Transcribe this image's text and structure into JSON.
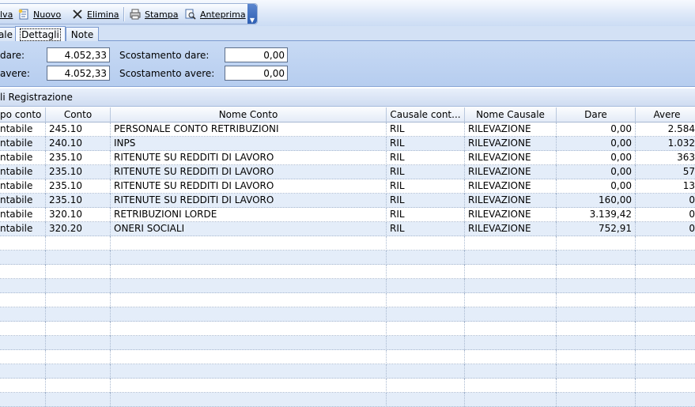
{
  "toolbar": {
    "buttons": [
      {
        "label": "lva",
        "icon": "save-icon"
      },
      {
        "label": "Nuovo",
        "icon": "new-document-icon"
      },
      {
        "label": "Elimina",
        "icon": "delete-x-icon"
      },
      {
        "label": "Stampa",
        "icon": "printer-icon"
      },
      {
        "label": "Anteprima",
        "icon": "print-preview-icon"
      }
    ],
    "more_icon": "chevron-down-icon"
  },
  "tabs": [
    {
      "label": "ale",
      "active": false
    },
    {
      "label": "Dettagli",
      "active": true
    },
    {
      "label": "Note",
      "active": false
    }
  ],
  "totals": {
    "dare_label": "dare:",
    "dare_value": "4.052,33",
    "avere_label": "avere:",
    "avere_value": "4.052,33",
    "scost_dare_label": "Scostamento dare:",
    "scost_dare_value": "0,00",
    "scost_avere_label": "Scostamento avere:",
    "scost_avere_value": "0,00"
  },
  "grid_title": "li Registrazione",
  "columns": [
    "po conto",
    "Conto",
    "Nome Conto",
    "Causale cont...",
    "Nome Causale",
    "Dare",
    "Avere"
  ],
  "rows": [
    [
      "ntabile",
      "245.10",
      "PERSONALE CONTO RETRIBUZIONI",
      "RIL",
      "RILEVAZIONE",
      "0,00",
      "2.584"
    ],
    [
      "ntabile",
      "240.10",
      "INPS",
      "RIL",
      "RILEVAZIONE",
      "0,00",
      "1.032"
    ],
    [
      "ntabile",
      "235.10",
      "RITENUTE SU REDDITI DI LAVORO",
      "RIL",
      "RILEVAZIONE",
      "0,00",
      "363"
    ],
    [
      "ntabile",
      "235.10",
      "RITENUTE SU REDDITI DI LAVORO",
      "RIL",
      "RILEVAZIONE",
      "0,00",
      "57"
    ],
    [
      "ntabile",
      "235.10",
      "RITENUTE SU REDDITI DI LAVORO",
      "RIL",
      "RILEVAZIONE",
      "0,00",
      "13"
    ],
    [
      "ntabile",
      "235.10",
      "RITENUTE SU REDDITI DI LAVORO",
      "RIL",
      "RILEVAZIONE",
      "160,00",
      "0"
    ],
    [
      "ntabile",
      "320.10",
      "RETRIBUZIONI LORDE",
      "RIL",
      "RILEVAZIONE",
      "3.139,42",
      "0"
    ],
    [
      "ntabile",
      "320.20",
      "ONERI SOCIALI",
      "RIL",
      "RILEVAZIONE",
      "752,91",
      "0"
    ]
  ],
  "colors": {
    "alt_row": "#e4edf9",
    "panel": "#c8daf4",
    "header_accent": "#2e5fb3"
  }
}
